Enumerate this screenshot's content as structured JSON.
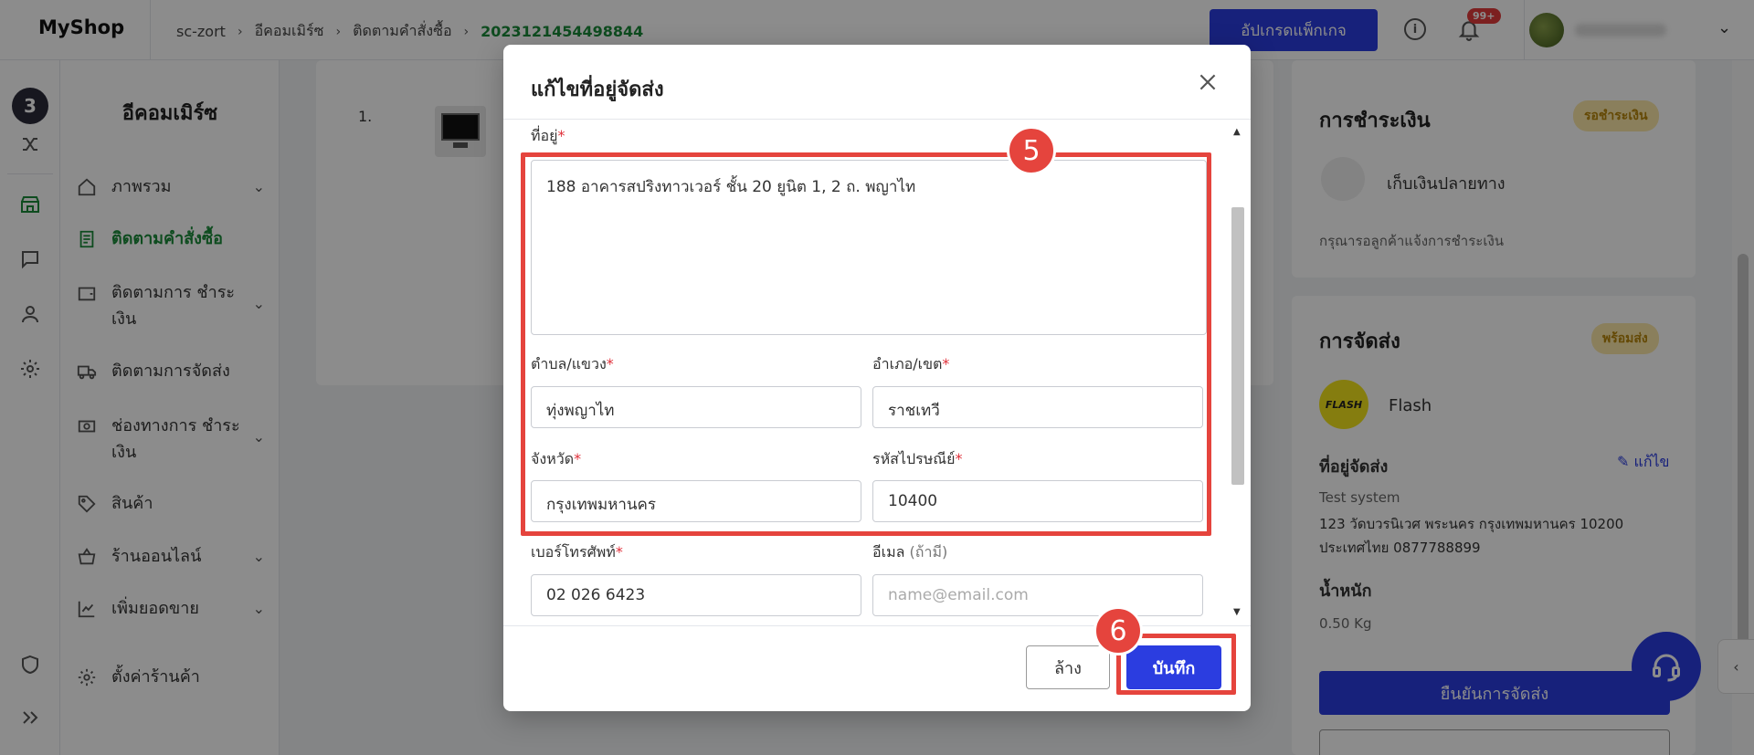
{
  "app": {
    "name": "MyShop"
  },
  "breadcrumb": [
    "sc-zort",
    "อีคอมเมิร์ซ",
    "ติดตามคำสั่งซื้อ",
    "2023121454498844"
  ],
  "header": {
    "upgrade_label": "อัปเกรดแพ็กเกจ",
    "notification_badge": "99+"
  },
  "nav": {
    "title": "อีคอมเมิร์ซ",
    "items": [
      {
        "label": "ภาพรวม",
        "icon": "home-icon"
      },
      {
        "label": "ติดตามคำสั่งซื้อ",
        "icon": "order-list-icon",
        "active": true
      },
      {
        "label": "ติดตามการ ชำระเงิน",
        "icon": "wallet-icon"
      },
      {
        "label": "ติดตามการจัดส่ง",
        "icon": "truck-icon"
      },
      {
        "label": "ช่องทางการ ชำระเงิน",
        "icon": "cash-icon"
      },
      {
        "label": "สินค้า",
        "icon": "tag-icon"
      },
      {
        "label": "ร้านออนไลน์",
        "icon": "basket-icon"
      },
      {
        "label": "เพิ่มยอดขาย",
        "icon": "chart-icon"
      },
      {
        "label": "ตั้งค่าร้านค้า",
        "icon": "gear-icon"
      }
    ]
  },
  "order": {
    "item_number": "1."
  },
  "payment": {
    "title": "การชำระเงิน",
    "status": "รอชำระเงิน",
    "method": "เก็บเงินปลายทาง",
    "note": "กรุณารอลูกค้าแจ้งการชำระเงิน"
  },
  "shipping": {
    "title": "การจัดส่ง",
    "status": "พร้อมส่ง",
    "carrier_logo_text": "FLASH",
    "carrier": "Flash",
    "address_label": "ที่อยู่จัดส่ง",
    "edit_label": "แก้ไข",
    "recipient": "Test system",
    "address_line1": "123 วัดบวรนิเวศ พระนคร กรุงเทพมหานคร 10200",
    "address_line2": "ประเทศไทย 0877788899",
    "weight_label": "น้ำหนัก",
    "weight_value": "0.50 Kg",
    "confirm_label": "ยืนยันการจัดส่ง"
  },
  "modal": {
    "title": "แก้ไขที่อยู่จัดส่ง",
    "address_label": "ที่อยู่",
    "address_value": "188 อาคารสปริงทาวเวอร์ ชั้น 20 ยูนิต 1, 2 ถ. พญาไท",
    "subdistrict_label": "ตำบล/แขวง",
    "subdistrict_value": "ทุ่งพญาไท",
    "district_label": "อำเภอ/เขต",
    "district_value": "ราชเทวี",
    "province_label": "จังหวัด",
    "province_value": "กรุงเทพมหานคร",
    "postcode_label": "รหัสไปรษณีย์",
    "postcode_value": "10400",
    "phone_label": "เบอร์โทรศัพท์",
    "phone_value": "02 026 6423",
    "email_label": "อีเมล",
    "email_optional": "(ถ้ามี)",
    "email_placeholder": "name@email.com",
    "clear_label": "ล้าง",
    "save_label": "บันทึก",
    "required_mark": "*"
  },
  "annotations": {
    "step_fields": "5",
    "step_save": "6",
    "color": "#e5443d"
  },
  "colors": {
    "primary": "#2b3de0",
    "active_green": "#1a8a3a",
    "required": "#e0303a",
    "pill_bg": "#fce7a8"
  }
}
